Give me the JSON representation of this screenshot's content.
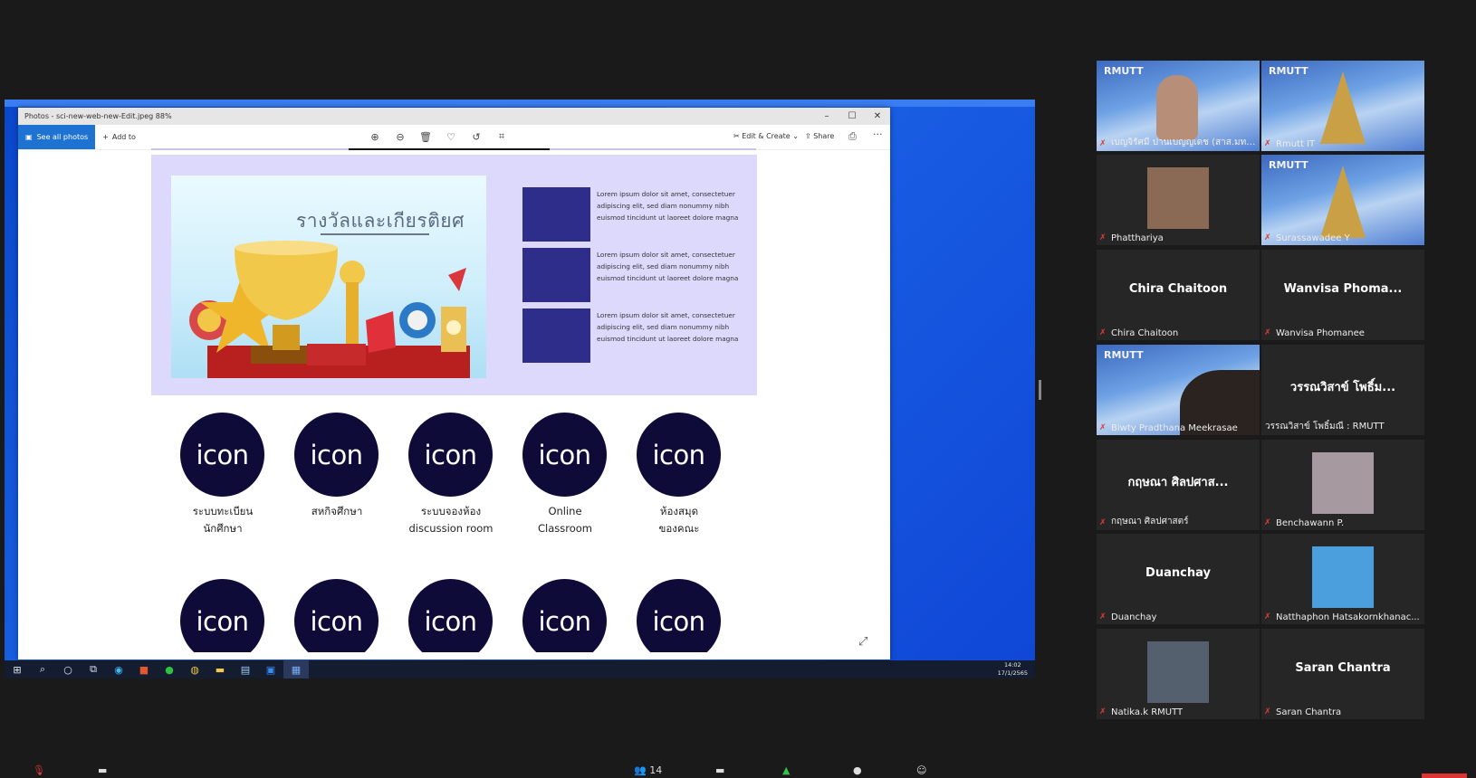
{
  "window": {
    "title": "Photos - sci-new-web-new-Edit.jpeg   88%",
    "minimize": "–",
    "maximize": "☐",
    "close": "✕"
  },
  "toolbar": {
    "see_all": "See all photos",
    "add_to": "Add to",
    "edit_create": "Edit & Create",
    "share": "Share"
  },
  "banner": {
    "title": "รางวัลและเกียรติยศ",
    "lorem": [
      "Lorem ipsum dolor sit amet, consectetuer adipiscing elit, sed diam nonummy nibh euismod tincidunt ut laoreet dolore magna",
      "Lorem ipsum dolor sit amet, consectetuer adipiscing elit, sed diam nonummy nibh euismod tincidunt ut laoreet dolore magna",
      "Lorem ipsum dolor sit amet, consectetuer adipiscing elit, sed diam nonummy nibh euismod tincidunt ut laoreet dolore magna"
    ]
  },
  "icon_row1": [
    {
      "icon": "icon",
      "label": "ระบบทะเบียน\nนักศึกษา"
    },
    {
      "icon": "icon",
      "label": "สหกิจศึกษา"
    },
    {
      "icon": "icon",
      "label": "ระบบจองห้อง\ndiscussion room"
    },
    {
      "icon": "icon",
      "label": "Online\nClassroom"
    },
    {
      "icon": "icon",
      "label": "ห้องสมุด\nของคณะ"
    }
  ],
  "icon_row2": [
    "icon",
    "icon",
    "icon",
    "icon",
    "icon"
  ],
  "taskbar": {
    "time": "14:02",
    "date": "17/1/2565"
  },
  "participants": [
    {
      "name": "เบญจิรัศมี ปานเบญญเดช (สาส.มทร.ธัญ...",
      "type": "video"
    },
    {
      "name": "Rmutt IT",
      "type": "video"
    },
    {
      "name": "Phatthariya",
      "type": "photo"
    },
    {
      "name": "Surassawadee Y",
      "type": "video"
    },
    {
      "name": "Chira Chaitoon",
      "type": "name",
      "display": "Chira Chaitoon"
    },
    {
      "name": "Wanvisa Phomanee",
      "type": "name",
      "display": "Wanvisa  Phoma..."
    },
    {
      "name": "Biwty Pradthana Meekrasae",
      "type": "video"
    },
    {
      "name": "วรรณวิสาข์ โพธิ์มณี : RMUTT",
      "type": "name",
      "display": "วรรณวิสาข์ โพธิ์ม..."
    },
    {
      "name": "กฤษณา  ศิลปศาสตร์",
      "type": "name",
      "display": "กฤษณา  ศิลปศาส..."
    },
    {
      "name": "Benchawann P.",
      "type": "photo"
    },
    {
      "name": "Duanchay",
      "type": "name",
      "display": "Duanchay"
    },
    {
      "name": "Natthaphon Hatsakornkhanac...",
      "type": "photo"
    },
    {
      "name": "Natika.k RMUTT",
      "type": "photo"
    },
    {
      "name": "Saran Chantra",
      "type": "name",
      "display": "Saran Chantra"
    }
  ],
  "video_logo": "RMUTT",
  "bottom": {
    "participants_count": "14"
  },
  "colors": {
    "active_speaker": "#c8ec52",
    "icon_circle": "#0e0b38",
    "lorem_box": "#2e2e8a",
    "banner_bg": "#dcd9fc"
  }
}
